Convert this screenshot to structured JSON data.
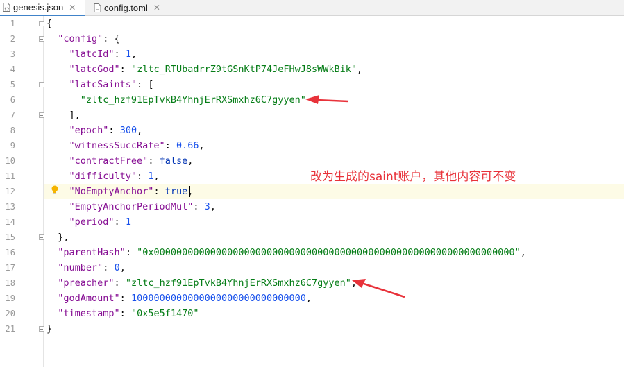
{
  "tabs": [
    {
      "label": "genesis.json",
      "active": true,
      "icon": "json-file-icon"
    },
    {
      "label": "config.toml",
      "active": false,
      "icon": "toml-file-icon"
    }
  ],
  "editor": {
    "current_line": 12,
    "lines": [
      {
        "n": "1"
      },
      {
        "n": "2"
      },
      {
        "n": "3"
      },
      {
        "n": "4"
      },
      {
        "n": "5"
      },
      {
        "n": "6"
      },
      {
        "n": "7"
      },
      {
        "n": "8"
      },
      {
        "n": "9"
      },
      {
        "n": "10"
      },
      {
        "n": "11"
      },
      {
        "n": "12"
      },
      {
        "n": "13"
      },
      {
        "n": "14"
      },
      {
        "n": "15"
      },
      {
        "n": "16"
      },
      {
        "n": "17"
      },
      {
        "n": "18"
      },
      {
        "n": "19"
      },
      {
        "n": "20"
      },
      {
        "n": "21"
      }
    ],
    "code": {
      "l1_brace": "{",
      "l2_key": "\"config\"",
      "l2_rest": ": {",
      "l3_key": "\"latcId\"",
      "l3_val": "1",
      "l4_key": "\"latcGod\"",
      "l4_val": "\"zltc_RTUbadrrZ9tGSnKtP74JeFHwJ8sWWkBik\"",
      "l5_key": "\"latcSaints\"",
      "l5_rest": ": [",
      "l6_val": "\"zltc_hzf91EpTvkB4YhnjErRXSmxhz6C7gyyen\"",
      "l7": "],",
      "l8_key": "\"epoch\"",
      "l8_val": "300",
      "l9_key": "\"witnessSuccRate\"",
      "l9_val": "0.66",
      "l10_key": "\"contractFree\"",
      "l10_val": "false",
      "l11_key": "\"difficulty\"",
      "l11_val": "1",
      "l12_key": "\"NoEmptyAnchor\"",
      "l12_val": "true",
      "l13_key": "\"EmptyAnchorPeriodMul\"",
      "l13_val": "3",
      "l14_key": "\"period\"",
      "l14_val": "1",
      "l15": "},",
      "l16_key": "\"parentHash\"",
      "l16_val": "\"0x0000000000000000000000000000000000000000000000000000000000000000\"",
      "l17_key": "\"number\"",
      "l17_val": "0",
      "l18_key": "\"preacher\"",
      "l18_val": "\"zltc_hzf91EpTvkB4YhnjErRXSmxhz6C7gyyen\"",
      "l19_key": "\"godAmount\"",
      "l19_val": "1000000000000000000000000000000",
      "l20_key": "\"timestamp\"",
      "l20_val": "\"0x5e5f1470\"",
      "l21": "}"
    }
  },
  "annotation": {
    "text": "改为生成的saint账户，其他内容可不变",
    "color": "#e8323a"
  }
}
